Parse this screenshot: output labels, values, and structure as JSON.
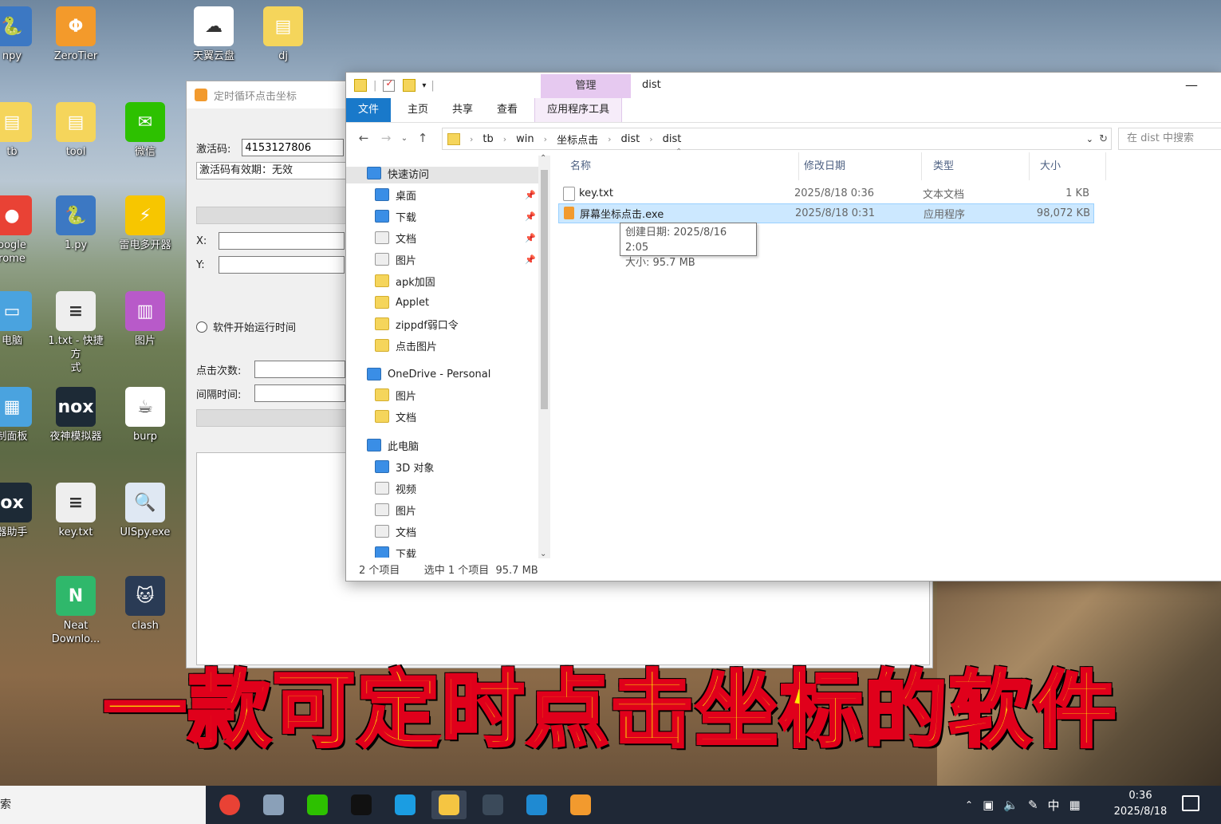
{
  "desktop": {
    "icons": [
      {
        "label": "npy",
        "color": "#3c78c3",
        "glyph": "🐍"
      },
      {
        "label": "ZeroTier",
        "color": "#f39a2b",
        "glyph": "Φ"
      },
      {
        "label": "天翼云盘",
        "color": "#ffffff",
        "glyph": "☁"
      },
      {
        "label": "dj",
        "color": "#f5d55b",
        "glyph": "▤"
      },
      {
        "label": "tb",
        "color": "#f5d55b",
        "glyph": "▤"
      },
      {
        "label": "tool",
        "color": "#f5d55b",
        "glyph": "▤"
      },
      {
        "label": "微信",
        "color": "#2dc100",
        "glyph": "✉"
      },
      {
        "label": "oogle\nrome",
        "color": "#e94235",
        "glyph": "●"
      },
      {
        "label": "1.py",
        "color": "#3c78c3",
        "glyph": "🐍"
      },
      {
        "label": "雷电多开器",
        "color": "#f7c600",
        "glyph": "⚡"
      },
      {
        "label": "电脑",
        "color": "#4aa3df",
        "glyph": "▭"
      },
      {
        "label": "1.txt - 快捷方\n式",
        "color": "#eeeeee",
        "glyph": "≡"
      },
      {
        "label": "图片",
        "color": "#b85ac9",
        "glyph": "▥"
      },
      {
        "label": "制面板",
        "color": "#4aa3df",
        "glyph": "▦"
      },
      {
        "label": "夜神模拟器",
        "color": "#1d2a36",
        "glyph": "nox"
      },
      {
        "label": "burp",
        "color": "#ffffff",
        "glyph": "☕"
      },
      {
        "label": "器助手",
        "color": "#1d2a36",
        "glyph": "ox"
      },
      {
        "label": "key.txt",
        "color": "#eeeeee",
        "glyph": "≡"
      },
      {
        "label": "UISpy.exe",
        "color": "#dfe8f3",
        "glyph": "🔍"
      },
      {
        "label": "Neat\nDownlo...",
        "color": "#2fb86b",
        "glyph": "N"
      },
      {
        "label": "clash",
        "color": "#2a3b55",
        "glyph": "🐱"
      }
    ]
  },
  "app_window": {
    "title": "定时循环点击坐标",
    "activation_label": "激活码:",
    "activation_value": "4153127806",
    "validity_text": "激活码有效期：无效",
    "x_label": "X:",
    "y_label": "Y:",
    "radio_label": "软件开始运行时间",
    "click_count_label": "点击次数:",
    "interval_label": "间隔时间:"
  },
  "explorer": {
    "context_tab": "管理",
    "window_title": "dist",
    "ribbon_tabs": [
      "文件",
      "主页",
      "共享",
      "查看",
      "应用程序工具"
    ],
    "breadcrumb": [
      "tb",
      "win",
      "坐标点击",
      "dist",
      "dist"
    ],
    "search_placeholder": "在 dist 中搜索",
    "nav_items": [
      {
        "label": "快速访问",
        "icon": "star-icon",
        "level": 0
      },
      {
        "label": "桌面",
        "icon": "desktop-icon",
        "level": 1,
        "pinned": true
      },
      {
        "label": "下载",
        "icon": "download-icon",
        "level": 1,
        "pinned": true
      },
      {
        "label": "文档",
        "icon": "document-icon",
        "level": 1,
        "pinned": true
      },
      {
        "label": "图片",
        "icon": "picture-icon",
        "level": 1,
        "pinned": true
      },
      {
        "label": "apk加固",
        "icon": "folder-icon",
        "level": 1
      },
      {
        "label": "Applet",
        "icon": "folder-icon",
        "level": 1
      },
      {
        "label": "zippdf弱口令",
        "icon": "folder-icon",
        "level": 1
      },
      {
        "label": "点击图片",
        "icon": "folder-icon",
        "level": 1
      },
      {
        "label": "OneDrive - Personal",
        "icon": "cloud-icon",
        "level": 0
      },
      {
        "label": "图片",
        "icon": "folder-icon",
        "level": 1
      },
      {
        "label": "文档",
        "icon": "folder-icon",
        "level": 1
      },
      {
        "label": "此电脑",
        "icon": "computer-icon",
        "level": 0
      },
      {
        "label": "3D 对象",
        "icon": "cube-icon",
        "level": 1
      },
      {
        "label": "视频",
        "icon": "video-icon",
        "level": 1
      },
      {
        "label": "图片",
        "icon": "picture-icon",
        "level": 1
      },
      {
        "label": "文档",
        "icon": "document-icon",
        "level": 1
      },
      {
        "label": "下载",
        "icon": "download-icon",
        "level": 1
      }
    ],
    "columns": [
      "名称",
      "修改日期",
      "类型",
      "大小"
    ],
    "files": [
      {
        "name": "key.txt",
        "date": "2025/8/18 0:36",
        "type": "文本文档",
        "size": "1 KB",
        "selected": false
      },
      {
        "name": "屏幕坐标点击.exe",
        "date": "2025/8/18 0:31",
        "type": "应用程序",
        "size": "98,072 KB",
        "selected": true
      }
    ],
    "tooltip": {
      "line1": "创建日期: 2025/8/16 2:05",
      "line2": "大小: 95.7 MB"
    },
    "status": {
      "count": "2 个项目",
      "selection": "选中 1 个项目  95.7 MB"
    }
  },
  "caption": "一款可定时点击坐标的软件",
  "taskbar": {
    "search_text": "索",
    "apps": [
      {
        "name": "chrome",
        "color": "#e94235"
      },
      {
        "name": "sandbox",
        "color": "#8aa0b8"
      },
      {
        "name": "wechat",
        "color": "#2dc100"
      },
      {
        "name": "qq",
        "color": "#111111"
      },
      {
        "name": "edge",
        "color": "#1b9de2"
      },
      {
        "name": "file-explorer",
        "color": "#f5c542"
      },
      {
        "name": "nox",
        "color": "#3b4a5a"
      },
      {
        "name": "vscode",
        "color": "#1f8ad2"
      },
      {
        "name": "click-app",
        "color": "#f29a2e"
      }
    ],
    "tray_ime": "中",
    "clock_time": "0:36",
    "clock_date": "2025/8/18"
  }
}
